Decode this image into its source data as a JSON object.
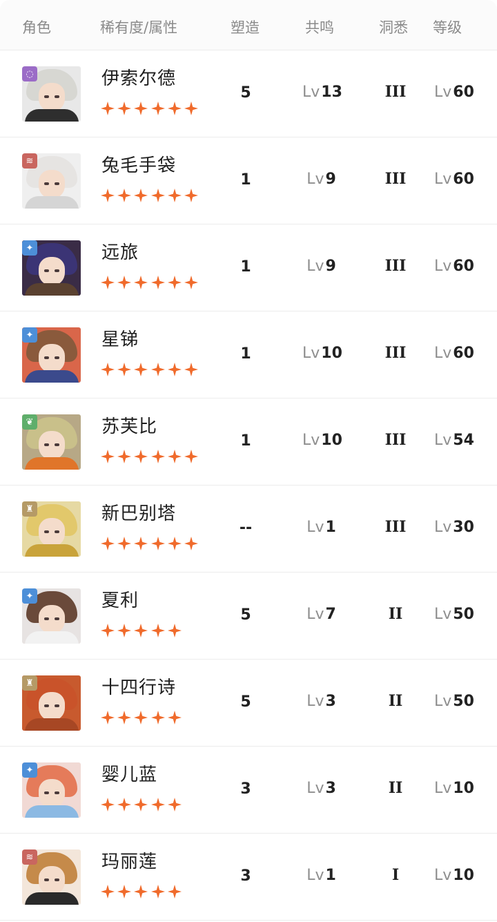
{
  "header": {
    "role": "角色",
    "rarity": "稀有度/属性",
    "shape": "塑造",
    "resonance": "共鸣",
    "insight": "洞悉",
    "level": "等级"
  },
  "lv_prefix": "Lv",
  "colors": {
    "star": "#f06b2c",
    "badge_purple": "#9b6cc7",
    "badge_red": "#c9665f",
    "badge_blue": "#4d8fd8",
    "badge_green": "#5fae6b",
    "badge_gold": "#b59a66"
  },
  "rows": [
    {
      "name": "伊索尔德",
      "stars": 6,
      "shape": "5",
      "resonance": "13",
      "insight": "III",
      "level": "60",
      "badge_icon": "purple-swirl-icon",
      "badge_color": "#9b6cc7",
      "glyph": "◌",
      "bg": "#e8e8e8",
      "hair": "#d7d7d2",
      "body": "#2e2e2e"
    },
    {
      "name": "兔毛手袋",
      "stars": 6,
      "shape": "1",
      "resonance": "9",
      "insight": "III",
      "level": "60",
      "badge_icon": "red-claw-icon",
      "badge_color": "#c9665f",
      "glyph": "≋",
      "bg": "#efefef",
      "hair": "#e6e4e2",
      "body": "#d5d5d5"
    },
    {
      "name": "远旅",
      "stars": 6,
      "shape": "1",
      "resonance": "9",
      "insight": "III",
      "level": "60",
      "badge_icon": "blue-star-icon",
      "badge_color": "#4d8fd8",
      "glyph": "✦",
      "bg": "#3a2c46",
      "hair": "#3b3475",
      "body": "#5a4130"
    },
    {
      "name": "星锑",
      "stars": 6,
      "shape": "1",
      "resonance": "10",
      "insight": "III",
      "level": "60",
      "badge_icon": "blue-star-icon",
      "badge_color": "#4d8fd8",
      "glyph": "✦",
      "bg": "#d9664a",
      "hair": "#8a5a3c",
      "body": "#3b4a8c"
    },
    {
      "name": "苏芙比",
      "stars": 6,
      "shape": "1",
      "resonance": "10",
      "insight": "III",
      "level": "54",
      "badge_icon": "green-leaf-icon",
      "badge_color": "#5fae6b",
      "glyph": "❦",
      "bg": "#b7a886",
      "hair": "#c9c08a",
      "body": "#e0752a"
    },
    {
      "name": "新巴别塔",
      "stars": 6,
      "shape": "--",
      "resonance": "1",
      "insight": "III",
      "level": "30",
      "badge_icon": "gold-tower-icon",
      "badge_color": "#b59a66",
      "glyph": "♜",
      "bg": "#e6d9a3",
      "hair": "#e2c86b",
      "body": "#c9a33a"
    },
    {
      "name": "夏利",
      "stars": 5,
      "shape": "5",
      "resonance": "7",
      "insight": "II",
      "level": "50",
      "badge_icon": "blue-star-icon",
      "badge_color": "#4d8fd8",
      "glyph": "✦",
      "bg": "#e7e3e2",
      "hair": "#6a4a3a",
      "body": "#f2f2f2"
    },
    {
      "name": "十四行诗",
      "stars": 5,
      "shape": "5",
      "resonance": "3",
      "insight": "II",
      "level": "50",
      "badge_icon": "gold-tower-icon",
      "badge_color": "#b59a66",
      "glyph": "♜",
      "bg": "#c85a2e",
      "hair": "#c9532a",
      "body": "#a74724"
    },
    {
      "name": "婴儿蓝",
      "stars": 5,
      "shape": "3",
      "resonance": "3",
      "insight": "II",
      "level": "10",
      "badge_icon": "blue-star-icon",
      "badge_color": "#4d8fd8",
      "glyph": "✦",
      "bg": "#f1d9d4",
      "hair": "#e57b5a",
      "body": "#8bb9e3"
    },
    {
      "name": "玛丽莲",
      "stars": 5,
      "shape": "3",
      "resonance": "1",
      "insight": "I",
      "level": "10",
      "badge_icon": "red-claw-icon",
      "badge_color": "#c9665f",
      "glyph": "≋",
      "bg": "#f3e6da",
      "hair": "#c58a4a",
      "body": "#2a2a2a"
    }
  ]
}
